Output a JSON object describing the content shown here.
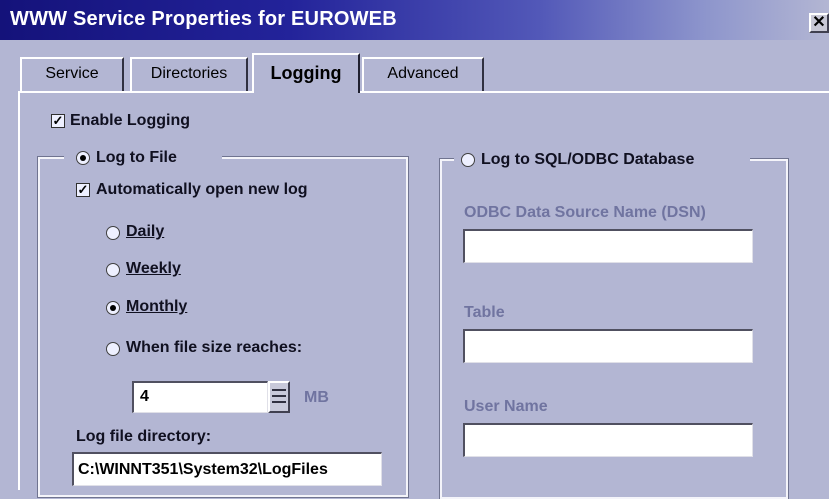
{
  "window": {
    "title": "WWW Service Properties for EUROWEB",
    "close_glyph": "✕"
  },
  "tabs": [
    {
      "label": "Service"
    },
    {
      "label": "Directories"
    },
    {
      "label": "Logging",
      "active": true
    },
    {
      "label": "Advanced"
    }
  ],
  "logging": {
    "enable_logging": {
      "label": "Enable Logging",
      "checked": true
    },
    "log_to_file": {
      "label": "Log to File",
      "selected": true,
      "auto_open_new_log": {
        "label": "Automatically open new log",
        "checked": true
      },
      "period_options": [
        {
          "label": "Daily",
          "selected": false
        },
        {
          "label": "Weekly",
          "selected": false
        },
        {
          "label": "Monthly",
          "selected": true
        },
        {
          "label": "When file size reaches:",
          "selected": false
        }
      ],
      "file_size": {
        "value": "4",
        "unit": "MB"
      },
      "directory": {
        "label": "Log file directory:",
        "value": "C:\\WINNT351\\System32\\LogFiles"
      }
    },
    "log_to_database": {
      "label": "Log to SQL/ODBC Database",
      "selected": false,
      "dsn": {
        "label": "ODBC Data Source Name (DSN)",
        "value": ""
      },
      "table": {
        "label": "Table",
        "value": ""
      },
      "user_name": {
        "label": "User Name",
        "value": ""
      }
    }
  },
  "colors": {
    "title_bar": "#1a1880",
    "dialog_bg": "#b3b6d3",
    "disabled_text": "#7074a0"
  }
}
